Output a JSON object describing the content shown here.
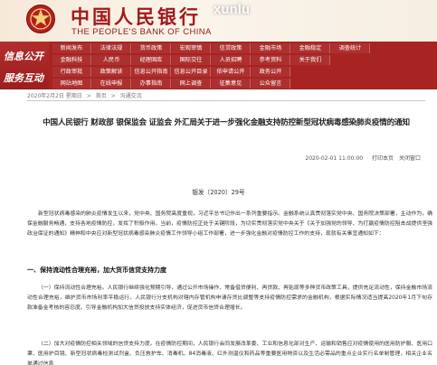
{
  "header": {
    "bank_name_cn": "中国人民银行",
    "bank_name_en": "THE PEOPLE'S BANK OF CHINA",
    "watermark": "xunlu",
    "emblem_icon": "pboc-emblem-icon",
    "brand_color": "#a1191b"
  },
  "nav": {
    "side_labels": [
      "信息公开",
      "服务互动"
    ],
    "rows": [
      [
        "新闻发布",
        "法律法规",
        "货币政策",
        "宏观审慎",
        "信贷政策",
        "金融市场",
        "金融稳定",
        "调查统计"
      ],
      [
        "金融科技",
        "人民币",
        "经理国库",
        "国际交往",
        "人员招聘",
        "参考资料",
        "关于我们"
      ],
      [
        "行政审批",
        "政策解读",
        "信息公开指南",
        "信息公开目录",
        "依申请公开",
        "政务公开"
      ],
      [
        "网站地图",
        "在线申报",
        "办事指南",
        "网上调查",
        "征集意见",
        "公众留言"
      ]
    ]
  },
  "breadcrumb": {
    "items": [
      "2020年2月2日 星期日",
      "首页",
      "沟通交流"
    ],
    "separator": ">"
  },
  "article": {
    "title": "中国人民银行  财政部  银保监会  证监会  外汇局关于进一步强化金融支持防控新型冠状病毒感染肺炎疫情的通知",
    "date": "2020-02-01 11:00:00",
    "print_label": "打印本页",
    "close_label": "关闭窗口",
    "doc_number": "银发〔2020〕29号",
    "intro": "新型冠状病毒感染的肺炎疫情发生以来，党中央、国务院高度重视，习近平总书记作出一系列重要指示。金融系统认真贯彻落实党中央、国务院决策部署，主动作为，确保金融服务畅通，支持各地疫情防控，发挥了积极作用。当前，疫情防控正处于关键阶段，为切实贯彻落实党中央关于《关于加强党的领导、为打赢疫情防控阻击战提供坚强政治保证的通知》精神和中央应对新型冠状病毒感染肺炎疫情工作领导小组工作部署，进一步强化金融对疫情防控工作的支持，现就有关事宜通知如下：",
    "section1_title": "一、保持流动性合理充裕，加大货币信贷支持力度",
    "section1_item1": "（一）保持流动性合理充裕。人民银行继续强化预期引导，通过公开市场操作、常备借贷便利、再贷款、再贴现等多种货币政策工具，提供充足流动性，保持金融市场流动性合理充裕，维护货币市场利率平稳运行。人民银行分支机构对辖内存管机构申请存贷比调整等支持疫情防控需求的金融机构，根据实际情况适当提高2020年1月下旬存款准备金考核的容忍度。引导金融机构加大信贷投放支持实体经济，促进货币信贷合理增长。",
    "section1_item2": "（二）加大对疫情防控相关领域的信贷支持力度。在疫情防控期间，人民银行会同发展改革委、工业和信息化部对生产、运输和销售应对疫情使用的医用防护服、医用口罩、医用护目镜、新型冠状病毒检测试剂盒、负压救护车、消毒机、84消毒液、红外测温仪和药品等重要医用物资以及生活必需品的重点企业实行名单制管理，相关企业名单通过信息"
  }
}
